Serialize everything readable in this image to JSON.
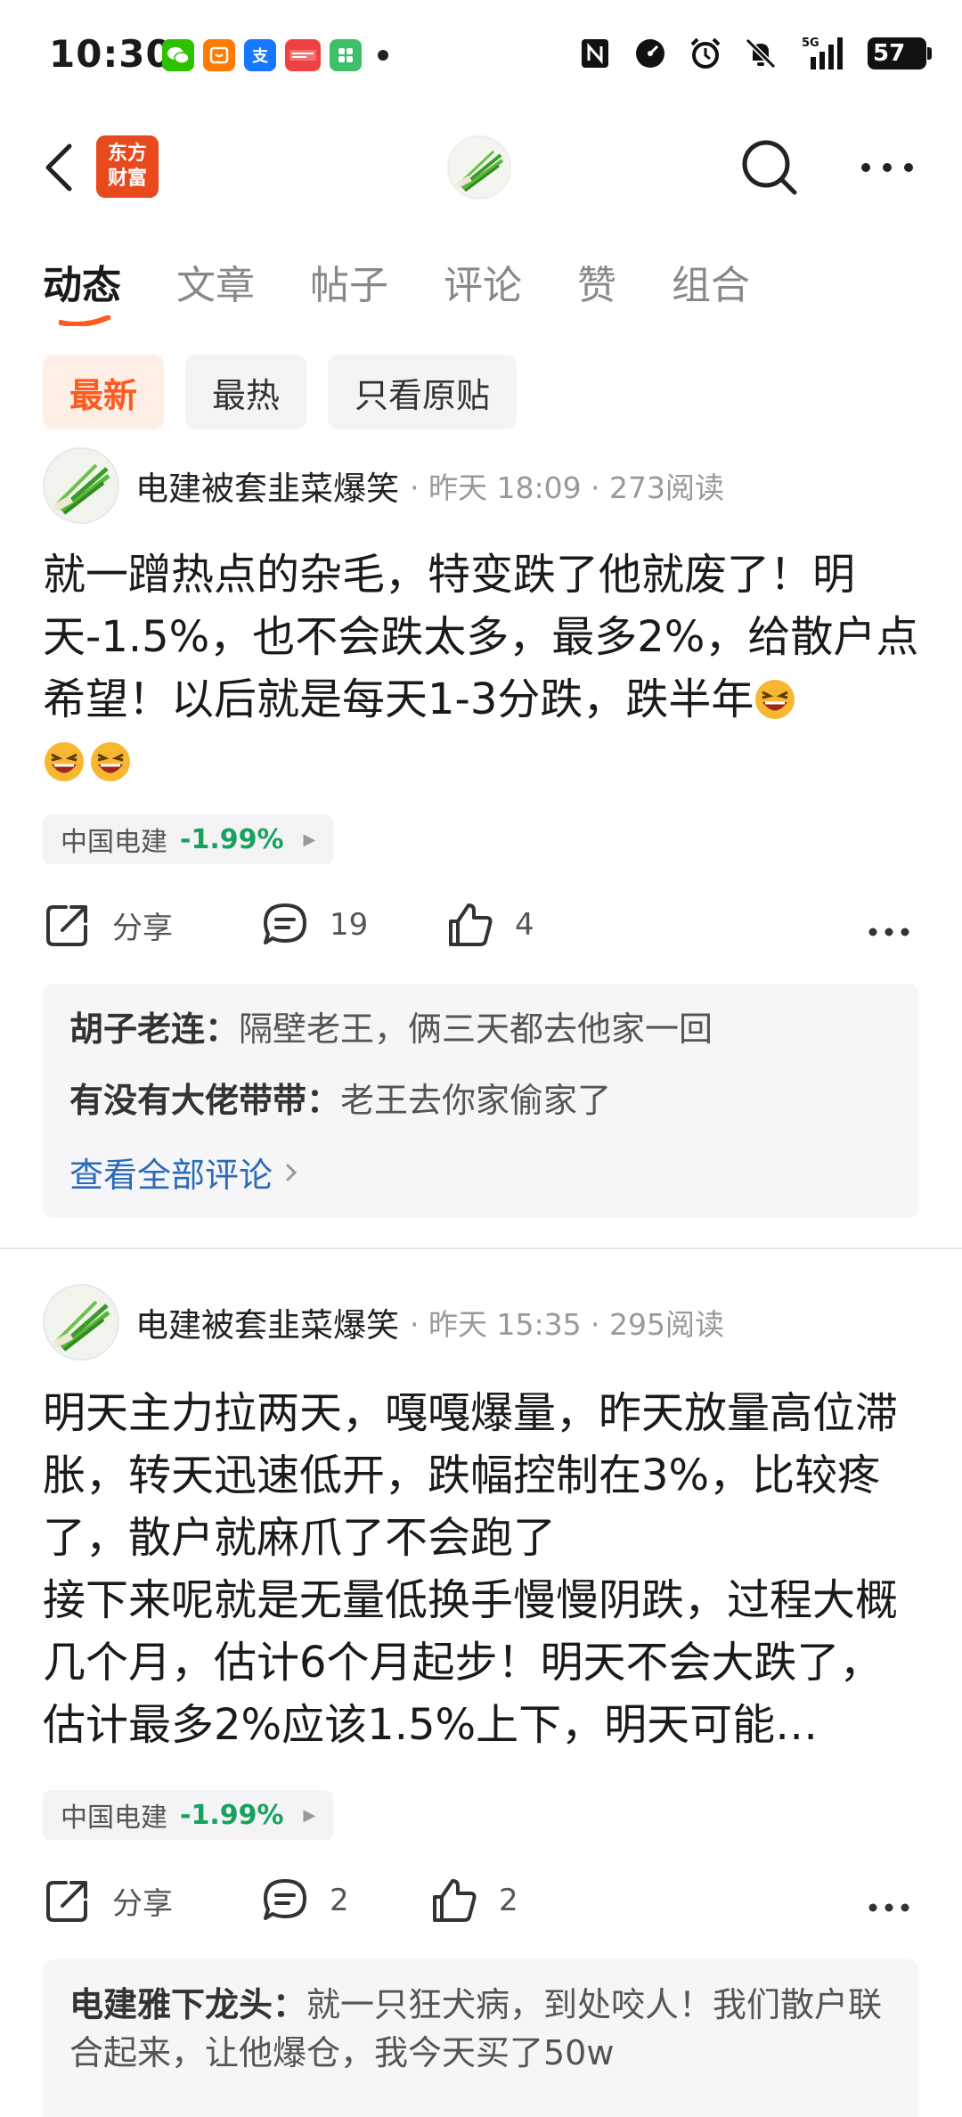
{
  "status": {
    "time": "10:30",
    "battery": "57",
    "network": "5G",
    "app_icons": [
      "wechat-icon",
      "taobao-icon",
      "alipay-icon",
      "toutiao-icon",
      "app-icon"
    ]
  },
  "header": {
    "logo_text_line1": "东方",
    "logo_text_line2": "财富"
  },
  "tabs": [
    {
      "label": "动态",
      "active": true
    },
    {
      "label": "文章",
      "active": false
    },
    {
      "label": "帖子",
      "active": false
    },
    {
      "label": "评论",
      "active": false
    },
    {
      "label": "赞",
      "active": false
    },
    {
      "label": "组合",
      "active": false
    }
  ],
  "filters": [
    {
      "label": "最新",
      "active": true
    },
    {
      "label": "最热",
      "active": false
    },
    {
      "label": "只看原贴",
      "active": false
    }
  ],
  "posts": [
    {
      "author": "电建被套韭菜爆笑",
      "meta": "· 昨天 18:09 · 273阅读",
      "body": "就一蹭热点的杂毛，特变跌了他就废了！明天-1.5%，也不会跌太多，最多2%，给散户点希望！以后就是每天1-3分跌，跌半年",
      "stock_name": "中国电建",
      "stock_change": "-1.99%",
      "share_label": "分享",
      "comment_count": "19",
      "like_count": "4",
      "comments": [
        {
          "user": "胡子老连：",
          "text": "隔壁老王，俩三天都去他家一回"
        },
        {
          "user": "有没有大佬带带：",
          "text": "老王去你家偷家了"
        }
      ],
      "see_all": "查看全部评论"
    },
    {
      "author": "电建被套韭菜爆笑",
      "meta": "· 昨天 15:35 · 295阅读",
      "body_line1": "明天主力拉两天，嘎嘎爆量，昨天放量高位滞胀，转天迅速低开，跌幅控制在3%，比较疼了，散户就麻爪了不会跑了",
      "body_line2": "接下来呢就是无量低换手慢慢阴跌，过程大概几个月，估计6个月起步！明天不会大跌了，估计最多2%应该1.5%上下，明天可能…",
      "stock_name": "中国电建",
      "stock_change": "-1.99%",
      "share_label": "分享",
      "comment_count": "2",
      "like_count": "2",
      "comments": [
        {
          "user": "电建雅下龙头：",
          "text": "就一只狂犬病，到处咬人！我们散户联合起来，让他爆仓，我今天买了50w"
        }
      ]
    }
  ],
  "colors": {
    "accent": "#ff5a1f",
    "down": "#19a15f",
    "link": "#2c6bb8"
  }
}
